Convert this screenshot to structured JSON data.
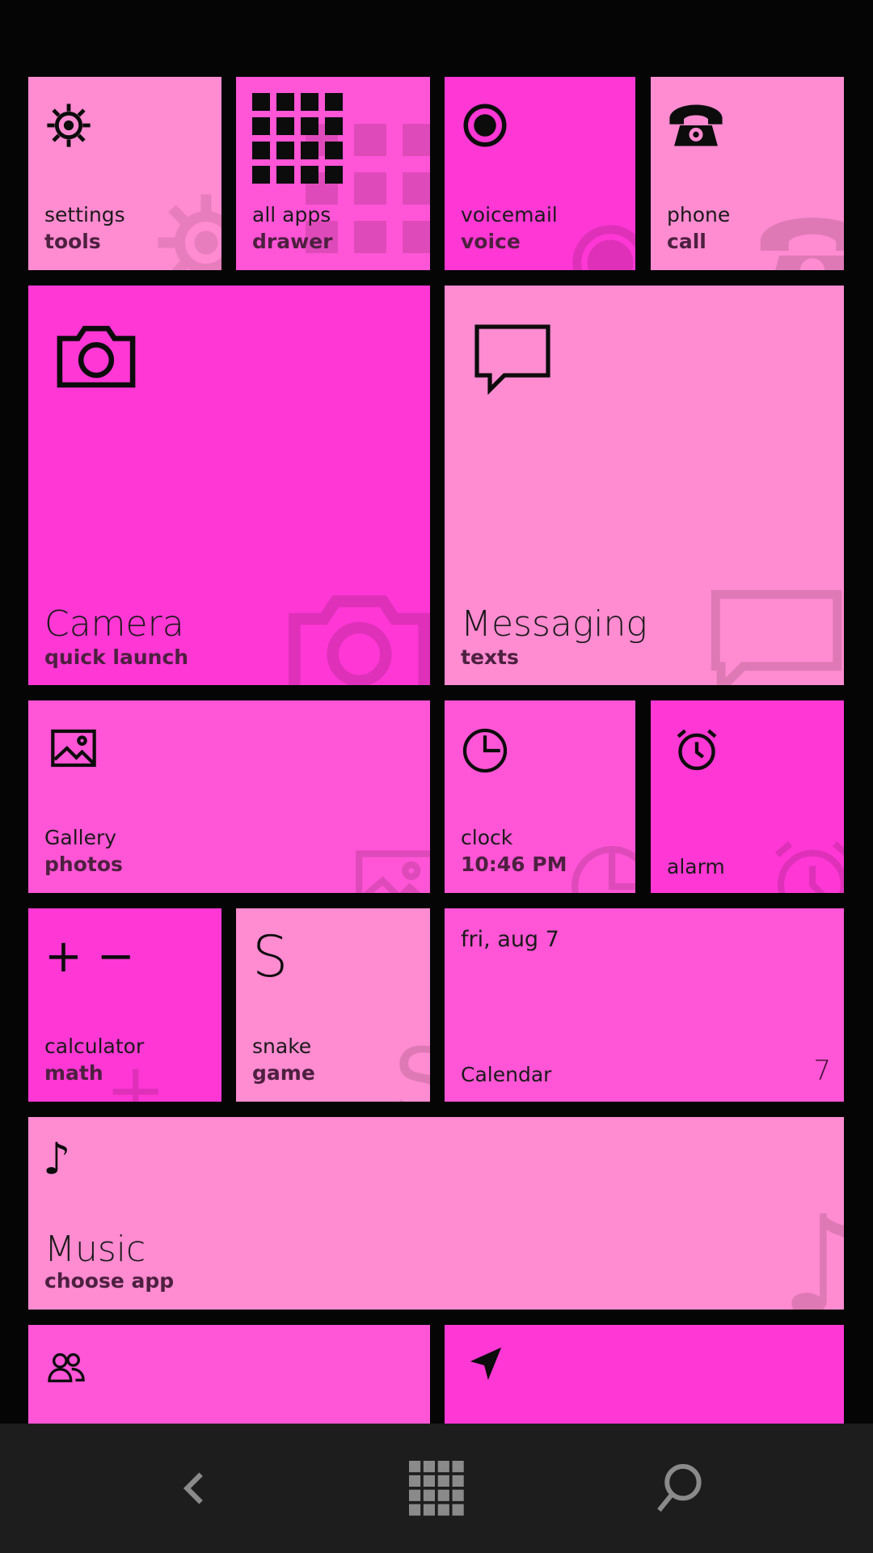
{
  "tiles": {
    "settings": {
      "title": "settings",
      "subtitle": "tools",
      "color": "#ff8bd1"
    },
    "all_apps": {
      "title": "all apps",
      "subtitle": "drawer",
      "color": "#ff55d6"
    },
    "voicemail": {
      "title": "voicemail",
      "subtitle": "voice",
      "color": "#ff37d5"
    },
    "phone": {
      "title": "phone",
      "subtitle": "call",
      "color": "#ff8bd1"
    },
    "camera": {
      "title": "Camera",
      "subtitle": "quick launch",
      "color": "#ff37d5"
    },
    "messaging": {
      "title": "Messaging",
      "subtitle": "texts",
      "color": "#ff8bd1"
    },
    "gallery": {
      "title": "Gallery",
      "subtitle": "photos",
      "color": "#ff55d6"
    },
    "clock": {
      "title": "clock",
      "subtitle": "10:46 PM",
      "color": "#ff55d6"
    },
    "alarm": {
      "title": "alarm",
      "color": "#ff37d5"
    },
    "calculator": {
      "title": "calculator",
      "subtitle": "math",
      "color": "#ff37d5",
      "icon_text": "+ −"
    },
    "snake": {
      "title": "snake",
      "subtitle": "game",
      "color": "#ff8bd1",
      "icon_text": "S"
    },
    "calendar": {
      "date": "fri, aug 7",
      "title": "Calendar",
      "day_number": "7",
      "color": "#ff55d6"
    },
    "music": {
      "title": "Music",
      "subtitle": "choose app",
      "color": "#ff8bd1",
      "icon_text": "♪"
    },
    "people": {
      "color": "#ff55d6"
    },
    "maps": {
      "color": "#ff37d5"
    }
  },
  "navigation": {
    "icons": [
      "back-icon",
      "app-grid-icon",
      "search-icon"
    ],
    "icon_color": "#8a8a8a"
  }
}
